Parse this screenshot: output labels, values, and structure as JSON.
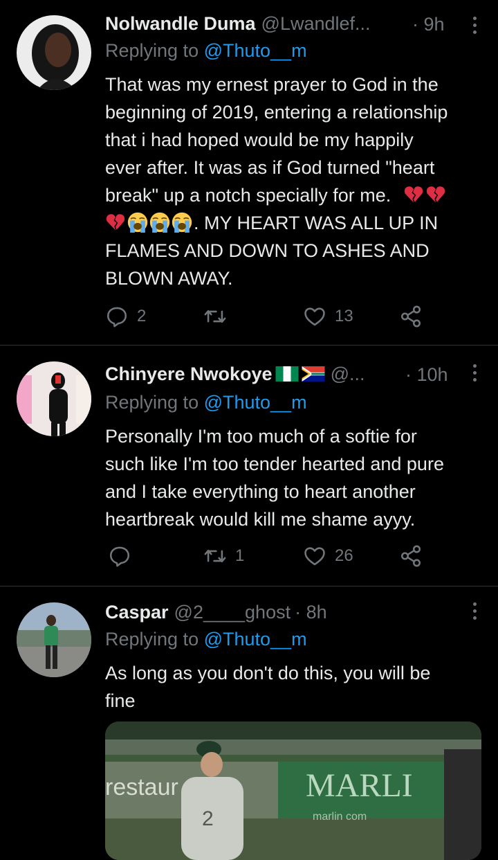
{
  "tweets": [
    {
      "name": "Nolwandle Duma",
      "handle": "@Lwandlef...",
      "time": "· 9h",
      "replying_prefix": "Replying to ",
      "replying_to": "@Thuto__m",
      "text_lines": [
        "That was my ernest prayer to God in the",
        "beginning of 2019, entering a relationship",
        "that i had hoped would be my happily",
        "ever after. It was as if God turned \"heart",
        "break\" up a notch specially for me."
      ],
      "text_after_emoji": ". MY HEART WAS ALL UP IN",
      "text_tail_lines": [
        "FLAMES AND DOWN TO ASHES AND",
        "BLOWN AWAY."
      ],
      "emojis": [
        "broken-heart",
        "broken-heart",
        "broken-heart",
        "loudly-crying-face",
        "loudly-crying-face",
        "loudly-crying-face"
      ],
      "replies": "2",
      "retweets": "",
      "likes": "13"
    },
    {
      "name": "Chinyere Nwokoye",
      "flags": [
        "nigeria-flag",
        "south-africa-flag"
      ],
      "handle": "@...",
      "time": "· 10h",
      "replying_prefix": "Replying to ",
      "replying_to": "@Thuto__m",
      "text_lines": [
        "Personally I'm too much of a softie for",
        "such like I'm too tender hearted and pure",
        "and I take  everything to heart another",
        "heartbreak would kill me shame ayyy."
      ],
      "replies": "",
      "retweets": "1",
      "likes": "26"
    },
    {
      "name": "Caspar",
      "handle": "@2____ghost",
      "time": "· 8h",
      "replying_prefix": "Replying to ",
      "replying_to": "@Thuto__m",
      "text_lines": [
        "As long as you don't do this, you will be",
        "fine"
      ],
      "media_texts": [
        "restaur",
        "MARLI",
        "marlin  com"
      ]
    }
  ],
  "colors": {
    "background": "#000000",
    "text": "#e7e9ea",
    "muted": "#71767b",
    "accent": "#1d9bf0",
    "divider": "#2f3336"
  }
}
